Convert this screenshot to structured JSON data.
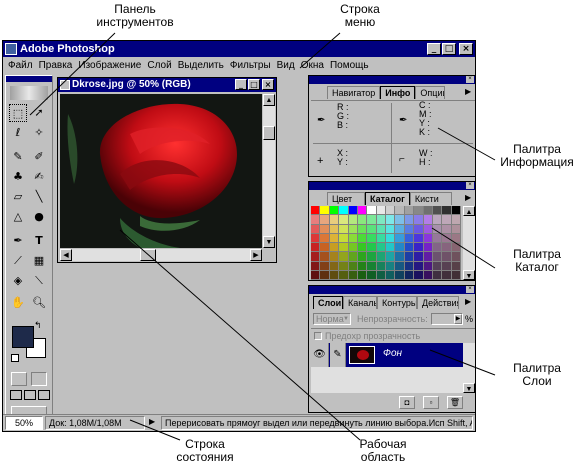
{
  "callouts": {
    "toolbox": "Панель\nинструментов",
    "menubar": "Строка\nменю",
    "info": "Палитра\nИнформация",
    "catalog": "Палитра\nКаталог",
    "layers": "Палитра\nСлои",
    "status": "Строка\nсостояния",
    "workarea": "Рабочая\nобласть"
  },
  "app": {
    "title": "Adobe Photoshop",
    "menu": [
      "Файл",
      "Правка",
      "Изображение",
      "Слой",
      "Выделить",
      "Фильтры",
      "Вид",
      "Окна",
      "Помощь"
    ]
  },
  "document": {
    "title": "Dkrose.jpg @ 50% (RGB)"
  },
  "info_palette": {
    "tabs": [
      "Навигатор",
      "Инфо",
      "Опции"
    ],
    "rgb": [
      "R :",
      "G :",
      "B :"
    ],
    "cmyk": [
      "C :",
      "M :",
      "Y :",
      "K :"
    ],
    "xy": [
      "X :",
      "Y :"
    ],
    "wh": [
      "W :",
      "H :"
    ]
  },
  "catalog_palette": {
    "tabs": [
      "Цвет",
      "Каталог",
      "Кисти"
    ]
  },
  "layers_palette": {
    "tabs": [
      "Слои",
      "Каналы",
      "Контуры",
      "Действия"
    ],
    "mode": "Норма",
    "opacity_label": "Непрозрачность:",
    "opacity_unit": "%",
    "preserve_label": "Предохр прозрачность",
    "layer_name": "Фон"
  },
  "statusbar": {
    "zoom": "50%",
    "doc_size": "Док: 1,08M/1,08M",
    "hint": "Перерисовать прямоуг выдел или передвинуть линию выбора.Исп Shift, Alt,"
  },
  "colors": {
    "title_active": "#000080",
    "window_gray": "#c0c0c0",
    "rose": "#c81018"
  }
}
